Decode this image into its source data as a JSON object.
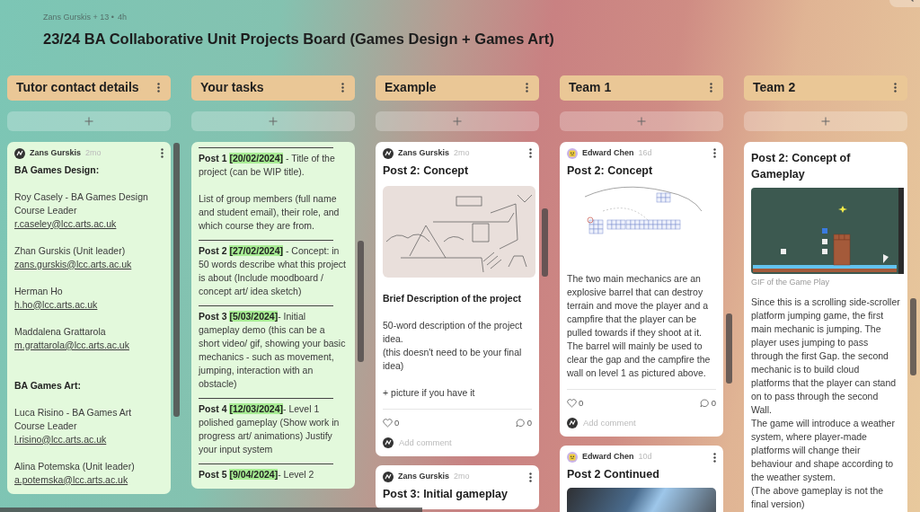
{
  "board": {
    "author": "Zans Gurskis + 13 •",
    "time": "4h",
    "title": "23/24 BA Collaborative Unit Projects Board (Games Design + Games Art)"
  },
  "columns": [
    {
      "title": "Tutor contact details",
      "posts": [
        {
          "kind": "note",
          "author": "Zans Gurskis",
          "time": "2mo",
          "avatar": {
            "kind": "logo"
          },
          "body": [
            {
              "kind": "heading",
              "text": "BA Games Design:"
            },
            {
              "kind": "contact",
              "text": "Roy Casely - BA Games Design Course Leader",
              "email": "r.caseley@lcc.arts.ac.uk"
            },
            {
              "kind": "contact",
              "text": "Zhan Gurskis (Unit leader)",
              "email": "zans.gurskis@lcc.arts.ac.uk"
            },
            {
              "kind": "contact",
              "text": "Herman Ho",
              "email": "h.ho@lcc.arts.ac.uk"
            },
            {
              "kind": "contact",
              "text": "Maddalena Grattarola",
              "email": "m.grattarola@lcc.arts.ac.uk"
            },
            {
              "kind": "heading",
              "text": "BA Games Art:"
            },
            {
              "kind": "contact",
              "text": "Luca Risino - BA Games Art Course Leader",
              "email": "l.risino@lcc.arts.ac.uk"
            },
            {
              "kind": "contact",
              "text": "Alina Potemska (Unit leader)",
              "email": "a.potemska@lcc.arts.ac.uk"
            }
          ]
        }
      ]
    },
    {
      "title": "Your tasks",
      "posts": [
        {
          "kind": "note",
          "body": [
            {
              "kind": "task",
              "label": "Post 1",
              "date": "[20/02/2024]",
              "text": " -  Title of the project (can be WIP title)."
            },
            {
              "kind": "text",
              "text": "List of group members (full name and student email), their role, and which course they are from."
            },
            {
              "kind": "task",
              "label": "Post 2",
              "date": "[27/02/2024]",
              "text": " - Concept: in 50 words describe what this project is about (Include moodboard / concept art/ idea sketch)"
            },
            {
              "kind": "task",
              "label": "Post 3",
              "date": "[5/03/2024]",
              "text": "- Initial gameplay demo (this can be a short video/ gif, showing your basic mechanics - such as movement, jumping, interaction with an obstacle)"
            },
            {
              "kind": "task",
              "label": "Post 4",
              "date": "[12/03/2024]",
              "text": "- Level 1 polished gameplay (Show work in progress art/ animations) Justify your input system"
            },
            {
              "kind": "task",
              "label": "Post 5",
              "date": "[9/04/2024]",
              "text": "- Level 2"
            }
          ]
        }
      ]
    },
    {
      "title": "Example",
      "posts": [
        {
          "kind": "card",
          "author": "Zans Gurskis",
          "time": "2mo",
          "avatar": {
            "kind": "logo"
          },
          "title": "Post 2: Concept",
          "image": {
            "kind": "sketch"
          },
          "body": [
            {
              "kind": "heading",
              "text": "Brief Description of the project"
            },
            {
              "kind": "text",
              "text": "50-word description of the project idea.\n(this doesn't need to be your final idea)"
            },
            {
              "kind": "text",
              "text": "+ picture if you have it"
            }
          ],
          "likes": "0",
          "comments": "0",
          "comment_placeholder": "Add comment"
        },
        {
          "kind": "card",
          "author": "Zans Gurskis",
          "time": "2mo",
          "avatar": {
            "kind": "logo"
          },
          "title": "Post 3: Initial gameplay"
        }
      ]
    },
    {
      "title": "Team 1",
      "posts": [
        {
          "kind": "card",
          "author": "Edward Chen",
          "time": "16d",
          "avatar": {
            "kind": "emoji"
          },
          "title": "Post 2: Concept",
          "image": {
            "kind": "grid"
          },
          "body": [
            {
              "kind": "text",
              "text": "The two main mechanics are an explosive barrel that can destroy terrain and move the player and a campfire that the player can be pulled towards if they shoot at it. The barrel will mainly be used to clear the gap and the campfire the wall on level 1 as pictured above."
            }
          ],
          "likes": "0",
          "comments": "0",
          "comment_placeholder": "Add comment"
        },
        {
          "kind": "card",
          "author": "Edward Chen",
          "time": "10d",
          "avatar": {
            "kind": "emoji"
          },
          "title": "Post 2 Continued",
          "image": {
            "kind": "photo"
          }
        }
      ]
    },
    {
      "title": "Team 2",
      "posts": [
        {
          "kind": "card",
          "title": "Post 2: Concept of Gameplay",
          "image": {
            "kind": "gameplay",
            "caption": "GIF of the Game Play"
          },
          "body": [
            {
              "kind": "text",
              "text": "Since this is a scrolling side-scroller platform jumping game, the first main mechanic is jumping. The player uses jumping to pass through the first Gap. the second mechanic is to build cloud platforms that the player can stand on to pass through the second Wall.\nThe game will introduce a weather system, where player-made platforms will change their behaviour and shape according to the weather system.\n(The above gameplay is not the final version)"
            }
          ]
        }
      ]
    }
  ]
}
